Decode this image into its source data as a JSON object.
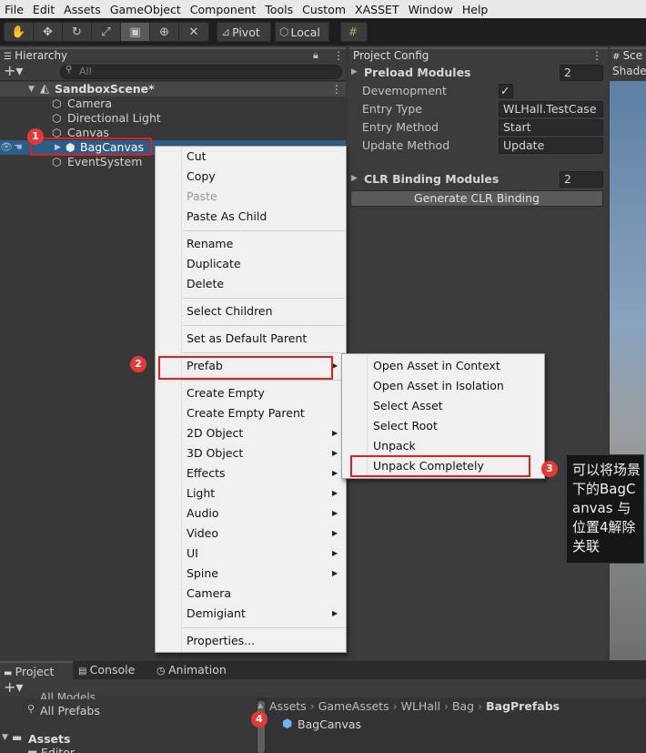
{
  "menubar": [
    "File",
    "Edit",
    "Assets",
    "GameObject",
    "Component",
    "Tools",
    "Custom",
    "XASSET",
    "Window",
    "Help"
  ],
  "toolbar": {
    "pivot": "Pivot",
    "local": "Local"
  },
  "hierarchy": {
    "tab": "Hierarchy",
    "search_placeholder": "All",
    "scene": "SandboxScene*",
    "items": [
      "Camera",
      "Directional Light",
      "Canvas",
      "BagCanvas",
      "EventSystem"
    ]
  },
  "config": {
    "tab": "Project Config",
    "preload_label": "Preload Modules",
    "preload_count": "2",
    "development_label": "Devemopment",
    "entry_type_label": "Entry Type",
    "entry_type_value": "WLHall.TestCase",
    "entry_method_label": "Entry Method",
    "entry_method_value": "Start",
    "update_method_label": "Update Method",
    "update_method_value": "Update",
    "clr_label": "CLR Binding Modules",
    "clr_count": "2",
    "clr_button": "Generate CLR Binding"
  },
  "scene": {
    "tab": "Sce",
    "shading": "Shade"
  },
  "context_menu": {
    "cut": "Cut",
    "copy": "Copy",
    "paste": "Paste",
    "paste_child": "Paste As Child",
    "rename": "Rename",
    "duplicate": "Duplicate",
    "delete": "Delete",
    "select_children": "Select Children",
    "set_default_parent": "Set as Default Parent",
    "prefab": "Prefab",
    "create_empty": "Create Empty",
    "create_empty_parent": "Create Empty Parent",
    "obj2d": "2D Object",
    "obj3d": "3D Object",
    "effects": "Effects",
    "light": "Light",
    "audio": "Audio",
    "video": "Video",
    "ui": "UI",
    "spine": "Spine",
    "camera": "Camera",
    "demigiant": "Demigiant",
    "properties": "Properties..."
  },
  "prefab_menu": {
    "open_context": "Open Asset in Context",
    "open_isolation": "Open Asset in Isolation",
    "select_asset": "Select Asset",
    "select_root": "Select Root",
    "unpack": "Unpack",
    "unpack_completely": "Unpack Completely"
  },
  "annotations": {
    "b1": "1",
    "b2": "2",
    "b3": "3",
    "b4": "4",
    "note": "可以将场景下的BagCanvas 与位置4解除关联"
  },
  "bottom": {
    "tabs": [
      "Project",
      "Console",
      "Animation"
    ],
    "left_items": [
      "All Models",
      "All Prefabs",
      "Assets",
      "Editor"
    ],
    "breadcrumb": [
      "Assets",
      "GameAssets",
      "WLHall",
      "Bag",
      "BagPrefabs"
    ],
    "asset": "BagCanvas"
  },
  "colors": {
    "selection": "#2c5d87",
    "annotation_red": "#e02020"
  }
}
